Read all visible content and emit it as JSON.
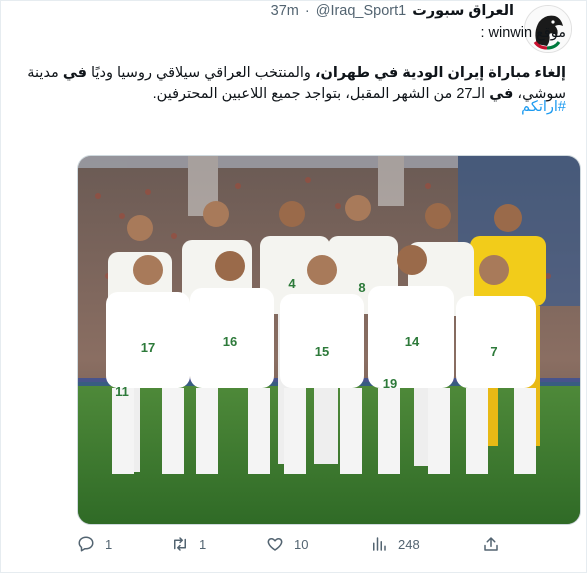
{
  "header": {
    "display_name": "العراق سبورت",
    "handle": "@Iraq_Sport1",
    "dot": "·",
    "time": "37m"
  },
  "tweet": {
    "source_line": "موقع winwin :",
    "text_bold_1": "إلغاء مباراة إيران الودية في طهران،",
    "text_normal_1": " والمنتخب العراقي سيلاقي روسيا وديًا ",
    "text_bold_2": "في",
    "text_normal_2": " مدينة سوشي، ",
    "text_bold_3": "في",
    "text_normal_3": " الـ27 من الشهر المقبل، بتواجد جميع اللاعبين المحترفين.",
    "hashtag": "#اراتكم"
  },
  "actions": {
    "reply_count": "1",
    "retweet_count": "1",
    "like_count": "10",
    "views_count": "248"
  },
  "jersey_numbers": [
    "17",
    "16",
    "15",
    "14",
    "7",
    "4",
    "8",
    "11",
    "19"
  ],
  "colors": {
    "accent": "#1d9bf0",
    "muted": "#536471"
  }
}
